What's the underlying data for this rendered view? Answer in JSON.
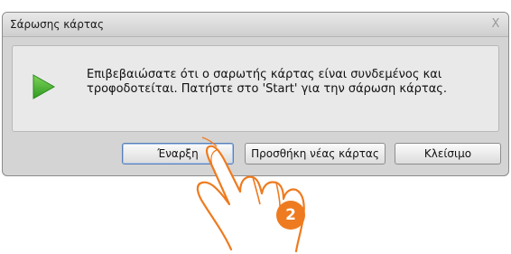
{
  "window": {
    "title": "Σάρωσης κάρτας",
    "close_glyph": "X"
  },
  "message": {
    "line1": "Επιβεβαιώσατε ότι ο σαρωτής κάρτας είναι συνδεμένος και",
    "line2": "τροφοδοτείται. Πατήστε στο 'Start' για την σάρωση κάρτας.",
    "icon": "play-arrow-icon"
  },
  "buttons": {
    "start_label": "Έναρξη",
    "add_card_label": "Προσθήκη νέας κάρτας",
    "close_label": "Κλείσιμο"
  },
  "callout": {
    "step_number": "2",
    "icon": "pointing-hand-icon"
  },
  "colors": {
    "icon_green": "#3fae2a",
    "hand_outline": "#ee7b1f",
    "badge": "#ee7b1f"
  }
}
